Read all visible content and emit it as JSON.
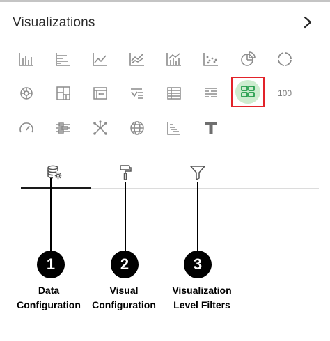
{
  "panel": {
    "title": "Visualizations"
  },
  "visualization_types": {
    "icons": [
      "bar-chart-icon",
      "horizontal-bar-chart-icon",
      "line-chart-icon",
      "area-chart-icon",
      "combo-chart-icon",
      "scatter-chart-icon",
      "pie-chart-icon",
      "donut-chart-icon",
      "sunburst-chart-icon",
      "treemap-icon",
      "pivot-table-icon",
      "tag-cloud-icon",
      "table-icon",
      "list-icon",
      "tile-icon",
      "kpi-tile-icon",
      "gauge-icon",
      "box-plot-icon",
      "network-icon",
      "map-icon",
      "waterfall-icon",
      "text-icon"
    ],
    "selected_icon": "tile-icon",
    "kpi_label": "100"
  },
  "tabs": [
    {
      "icon": "database-settings-icon"
    },
    {
      "icon": "paint-roller-icon"
    },
    {
      "icon": "filter-icon"
    }
  ],
  "active_tab_index": 0,
  "callouts": [
    {
      "number": "1",
      "line1": "Data",
      "line2": "Configuration"
    },
    {
      "number": "2",
      "line1": "Visual",
      "line2": "Configuration"
    },
    {
      "number": "3",
      "line1": "Visualization",
      "line2": "Level Filters"
    }
  ],
  "colors": {
    "highlight_border": "#e2232a",
    "selected_fill": "#cdeccf",
    "selected_icon": "#1f9a47",
    "icon_gray": "#8c8c8c"
  }
}
